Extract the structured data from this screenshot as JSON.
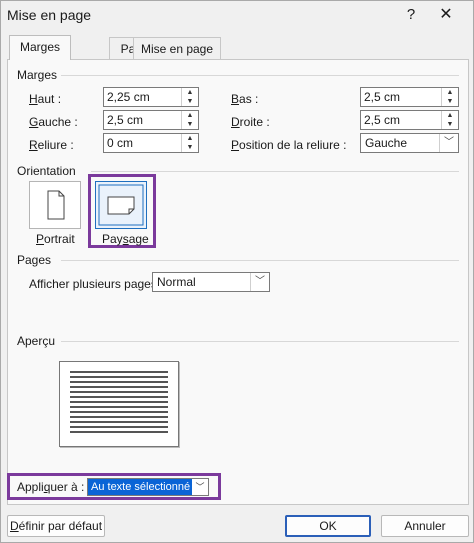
{
  "window": {
    "title": "Mise en page",
    "help_icon": "?",
    "close_icon": "✕"
  },
  "tabs": [
    {
      "label": "Marges"
    },
    {
      "label": "Papier"
    },
    {
      "label": "Mise en page"
    }
  ],
  "margins": {
    "section_label": "Marges",
    "haut": {
      "prefix": "H",
      "rest": "aut :",
      "value": "2,25 cm"
    },
    "gauche": {
      "prefix": "G",
      "rest": "auche :",
      "value": "2,5 cm"
    },
    "reliure": {
      "prefix": "R",
      "rest": "eliure :",
      "value": "0 cm"
    },
    "bas": {
      "prefix": "B",
      "rest": "as :",
      "value": "2,5 cm"
    },
    "droite": {
      "prefix": "D",
      "rest": "roite :",
      "value": "2,5 cm"
    },
    "position_reliure": {
      "prefix": "P",
      "rest": "osition de la reliure :",
      "value": "Gauche"
    }
  },
  "orientation": {
    "section_label": "Orientation",
    "portrait_prefix": "P",
    "portrait_rest": "ortrait",
    "paysage_before": "Pay",
    "paysage_u": "s",
    "paysage_after": "age"
  },
  "pages": {
    "section_label": "Pages",
    "multi_label": "Afficher plusieurs pages :",
    "multi_value": "Normal"
  },
  "apercu": {
    "section_label": "Aperçu"
  },
  "apply": {
    "label_before": "Appli",
    "label_u": "q",
    "label_after": "uer à :",
    "value": "Au texte sélectionné"
  },
  "buttons": {
    "default_prefix": "D",
    "default_rest": "éfinir par défaut",
    "ok": "OK",
    "cancel": "Annuler"
  },
  "colors": {
    "highlight": "#7b3a9c",
    "selection": "#0a64d6",
    "ok_border": "#2b5fb8"
  }
}
